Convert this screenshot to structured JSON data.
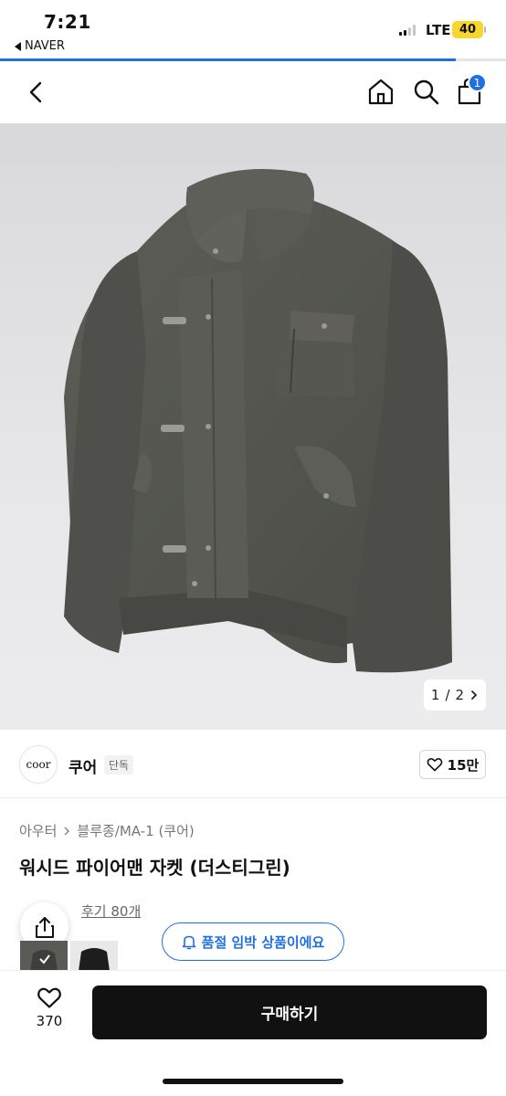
{
  "status_bar": {
    "time": "7:21",
    "back_app": "NAVER",
    "network": "LTE",
    "battery": "40",
    "signal_bars": 4,
    "signal_active": 2
  },
  "page_load_progress": 0.9,
  "nav": {
    "back_icon": "chevron-left-icon",
    "home_icon": "home-icon",
    "search_icon": "search-icon",
    "cart_icon": "bag-icon",
    "cart_count": "1"
  },
  "gallery": {
    "current": "1",
    "separator": "/",
    "total": "2"
  },
  "brand": {
    "logo_text": "coor",
    "name": "쿠어",
    "tag": "단독",
    "likes": "15만"
  },
  "product": {
    "breadcrumb": [
      "아우터",
      "블루종/MA-1 (쿠어)"
    ],
    "title": "워시드 파이어맨 자켓 (더스티그린)",
    "review_text": "후기 80개"
  },
  "notice": {
    "label": "품절 임박 상품이에요"
  },
  "bottom": {
    "wish_count": "370",
    "buy_label": "구매하기"
  },
  "colors": {
    "accent": "#1f6fe5",
    "buy_button": "#111111",
    "battery": "#f7d62e"
  }
}
